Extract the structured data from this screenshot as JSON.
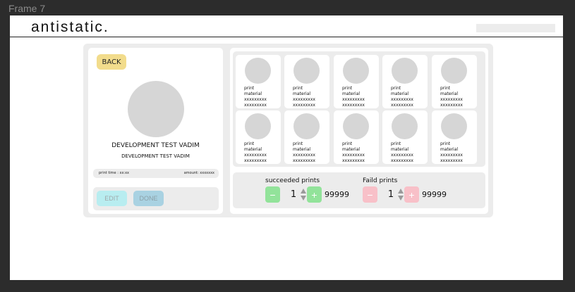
{
  "frame": {
    "label": "Frame 7"
  },
  "header": {
    "logo_text": "antistatic.",
    "search_placeholder": ""
  },
  "left_panel": {
    "back_label": "BACK",
    "title": "DEVELOPMENT TEST VADIM",
    "subtitle": "DEVELOPMENT TEST VADIM",
    "print_time": "print time : xx:xx",
    "amount": "amount: xxxxxxx",
    "edit_label": "EDIT",
    "done_label": "DONE"
  },
  "cards": [
    {
      "line1": "print",
      "line2": "material",
      "line3": "xxxxxxxxx",
      "line4": "xxxxxxxxx"
    },
    {
      "line1": "print",
      "line2": "material",
      "line3": "xxxxxxxxx",
      "line4": "xxxxxxxxx"
    },
    {
      "line1": "print",
      "line2": "material",
      "line3": "xxxxxxxxx",
      "line4": "xxxxxxxxx"
    },
    {
      "line1": "print",
      "line2": "material",
      "line3": "xxxxxxxxx",
      "line4": "xxxxxxxxx"
    },
    {
      "line1": "print",
      "line2": "material",
      "line3": "xxxxxxxxx",
      "line4": "xxxxxxxxx"
    },
    {
      "line1": "print",
      "line2": "material",
      "line3": "xxxxxxxxx",
      "line4": "xxxxxxxxx"
    },
    {
      "line1": "print",
      "line2": "material",
      "line3": "xxxxxxxxx",
      "line4": "xxxxxxxxx"
    },
    {
      "line1": "print",
      "line2": "material",
      "line3": "xxxxxxxxx",
      "line4": "xxxxxxxxx"
    },
    {
      "line1": "print",
      "line2": "material",
      "line3": "xxxxxxxxx",
      "line4": "xxxxxxxxx"
    },
    {
      "line1": "print",
      "line2": "material",
      "line3": "xxxxxxxxx",
      "line4": "xxxxxxxxx"
    }
  ],
  "counters": {
    "succeeded": {
      "title": "succeeded prints",
      "minus": "−",
      "value": "1",
      "plus": "+",
      "max": "99999"
    },
    "failed": {
      "title": "Faild prints",
      "minus": "−",
      "value": "1",
      "plus": "+",
      "max": "99999"
    }
  },
  "colors": {
    "back_button": "#f2dc8c",
    "edit_button": "#b8edf0",
    "done_button": "#a9d2e2",
    "success_green": "#92e39a",
    "failed_pink": "#f8c0c8",
    "panel_gray": "#ececec",
    "placeholder_circle": "#d6d6d6"
  },
  "icons": {
    "spin_up": "triangle-up-icon",
    "spin_down": "triangle-down-icon"
  }
}
